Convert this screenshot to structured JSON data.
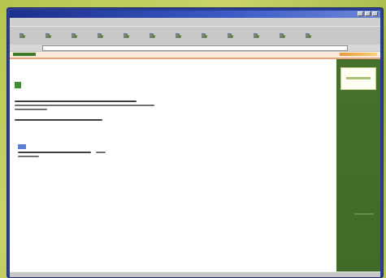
{
  "window": {
    "title": "",
    "menus": [
      "",
      "",
      "",
      "",
      "",
      ""
    ]
  },
  "toolbar": {
    "icons": [
      "back-icon",
      "forward-icon",
      "stop-icon",
      "refresh-icon",
      "home-icon",
      "search-icon",
      "favorites-icon",
      "history-icon",
      "mail-icon",
      "print-icon",
      "edit-icon",
      "discuss-icon"
    ]
  },
  "page": {
    "heading": ""
  },
  "colors": {
    "frame": "#2a3c8e",
    "sidebar": "#46702c",
    "accent_green": "#3f8f2a",
    "strip": "#fbe9dc",
    "strip_border": "#e7a37b",
    "link": "#5b7fd6"
  }
}
